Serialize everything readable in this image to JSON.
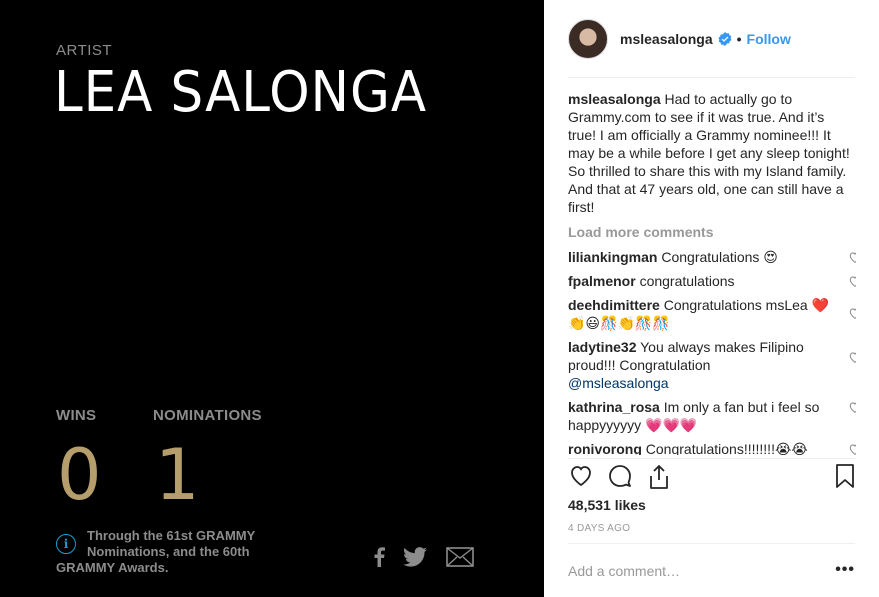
{
  "photo": {
    "artist_label": "ARTIST",
    "artist_name": "LEA SALONGA",
    "wins_label": "WINS",
    "wins_value": "0",
    "nominations_label": "NOMINATIONS",
    "nominations_value": "1",
    "info_icon": "info-icon",
    "info_line1": "Through the 61st GRAMMY",
    "info_line2": "Nominations, and the 60th",
    "info_line3": "GRAMMY Awards.",
    "share_icons": [
      "facebook-icon",
      "twitter-icon",
      "email-icon"
    ],
    "accent_color": "#b59e6c"
  },
  "post": {
    "username": "msleasalonga",
    "verified_icon": "verified-badge-icon",
    "separator": "•",
    "follow_label": "Follow",
    "caption_user": "msleasalonga",
    "caption_text": "Had to actually go to Grammy.com to see if it was true. And it’s true! I am officially a Grammy nominee!!! It may be a while before I get any sleep tonight! So thrilled to share this with my Island family. And that at 47 years old, one can still have a first!",
    "load_more_label": "Load more comments",
    "comments": [
      {
        "user": "liliankingman",
        "text": "Congratulations 😍"
      },
      {
        "user": "fpalmenor",
        "text": "congratulations"
      },
      {
        "user": "deehdimittere",
        "text": "Congratulations msLea ❤️👏😃🎊👏🎊🎊"
      },
      {
        "user": "ladytine32",
        "text": "You always makes Filipino proud!!! Congratulation",
        "mention": "@msleasalonga"
      },
      {
        "user": "kathrina_rosa",
        "text": "Im only a fan but i feel so happyyyyyy 💗💗💗"
      },
      {
        "user": "ronivorong",
        "text": "Congratulations!!!!!!!!😭😭"
      }
    ],
    "likes": "48,531 likes",
    "timestamp": "4 DAYS AGO",
    "add_comment_placeholder": "Add a comment…",
    "more_label": "•••",
    "link_color": "#3897f0"
  }
}
